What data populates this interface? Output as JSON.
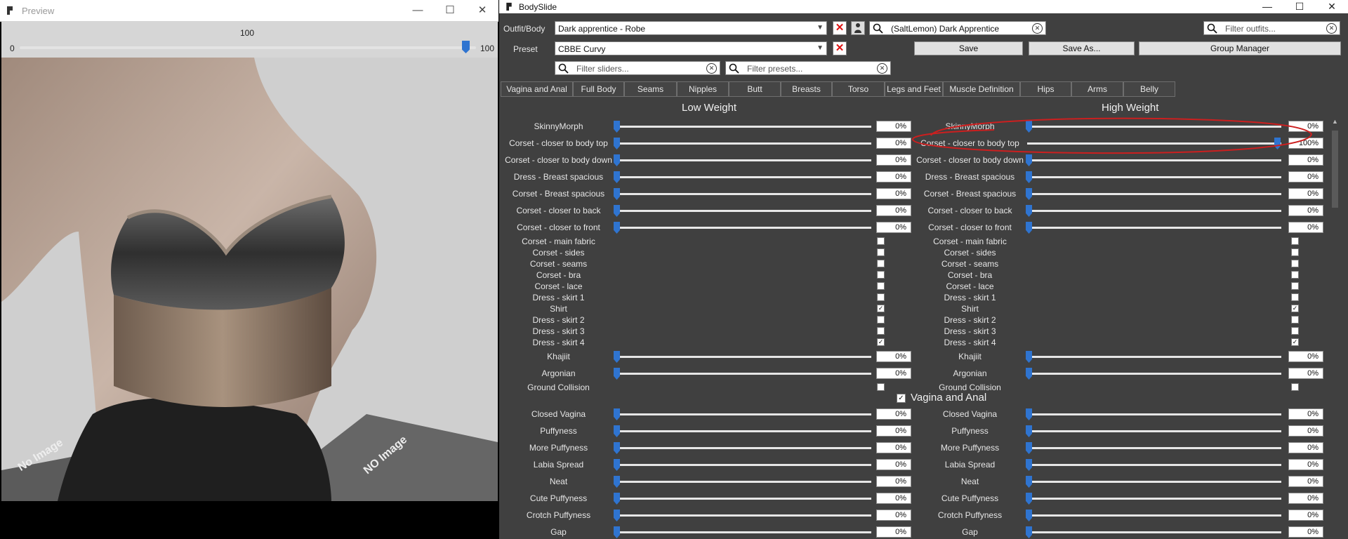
{
  "preview": {
    "title": "Preview",
    "slider_value": "100",
    "slider_min": "0",
    "slider_max": "100",
    "slider_level": 1.0,
    "floor_text": [
      "No Image",
      "NO",
      "Image",
      "NO",
      "Image",
      "NO",
      "Image",
      "NO",
      "Image"
    ]
  },
  "bodyslide": {
    "title": "BodySlide",
    "outfit_label": "Outfit/Body",
    "outfit_value": "Dark apprentice - Robe",
    "preset_label": "Preset",
    "preset_value": "CBBE Curvy",
    "outfit_search_value": "(SaltLemon) Dark Apprentice",
    "outfits_filter_placeholder": "Filter outfits...",
    "sliders_filter_placeholder": "Filter sliders...",
    "presets_filter_placeholder": "Filter presets...",
    "save_label": "Save",
    "save_as_label": "Save As...",
    "group_manager_label": "Group Manager",
    "tabs": [
      "Vagina and Anal",
      "Full Body",
      "Seams",
      "Nipples",
      "Butt",
      "Breasts",
      "Torso",
      "Legs and Feet",
      "Muscle Definition",
      "Hips",
      "Arms",
      "Belly"
    ],
    "low_weight_label": "Low Weight",
    "high_weight_label": "High Weight",
    "group_header": "Vagina and Anal",
    "group_checked": true
  },
  "sliders_top": [
    {
      "label": "SkinnyMorph",
      "type": "slider",
      "low": "0%",
      "high": "0%",
      "low_level": 0,
      "high_level": 0
    },
    {
      "label": "Corset - closer to body top",
      "type": "slider",
      "low": "0%",
      "high": "100%",
      "low_level": 0,
      "high_level": 1
    },
    {
      "label": "Corset - closer to body down",
      "type": "slider",
      "low": "0%",
      "high": "0%",
      "low_level": 0,
      "high_level": 0
    },
    {
      "label": "Dress - Breast spacious",
      "type": "slider",
      "low": "0%",
      "high": "0%",
      "low_level": 0,
      "high_level": 0
    },
    {
      "label": "Corset - Breast spacious",
      "type": "slider",
      "low": "0%",
      "high": "0%",
      "low_level": 0,
      "high_level": 0
    },
    {
      "label": "Corset - closer to back",
      "type": "slider",
      "low": "0%",
      "high": "0%",
      "low_level": 0,
      "high_level": 0
    },
    {
      "label": "Corset - closer to front",
      "type": "slider",
      "low": "0%",
      "high": "0%",
      "low_level": 0,
      "high_level": 0
    },
    {
      "label": "Corset - main fabric",
      "type": "check",
      "low_checked": false,
      "high_checked": false
    },
    {
      "label": "Corset - sides",
      "type": "check",
      "low_checked": false,
      "high_checked": false
    },
    {
      "label": "Corset - seams",
      "type": "check",
      "low_checked": false,
      "high_checked": false
    },
    {
      "label": "Corset - bra",
      "type": "check",
      "low_checked": false,
      "high_checked": false
    },
    {
      "label": "Corset - lace",
      "type": "check",
      "low_checked": false,
      "high_checked": false
    },
    {
      "label": "Dress - skirt 1",
      "type": "check",
      "low_checked": false,
      "high_checked": false
    },
    {
      "label": "Shirt",
      "type": "check",
      "low_checked": true,
      "high_checked": true
    },
    {
      "label": "Dress - skirt 2",
      "type": "check",
      "low_checked": false,
      "high_checked": false
    },
    {
      "label": "Dress - skirt 3",
      "type": "check",
      "low_checked": false,
      "high_checked": false
    },
    {
      "label": "Dress - skirt 4",
      "type": "check",
      "low_checked": true,
      "high_checked": true
    },
    {
      "label": "Khajiit",
      "type": "slider",
      "low": "0%",
      "high": "0%",
      "low_level": 0,
      "high_level": 0
    },
    {
      "label": "Argonian",
      "type": "slider",
      "low": "0%",
      "high": "0%",
      "low_level": 0,
      "high_level": 0
    },
    {
      "label": "Ground Collision",
      "type": "check",
      "low_checked": false,
      "high_checked": false
    }
  ],
  "sliders_group": [
    {
      "label": "Closed Vagina",
      "type": "slider",
      "low": "0%",
      "high": "0%",
      "low_level": 0,
      "high_level": 0
    },
    {
      "label": "Puffyness",
      "type": "slider",
      "low": "0%",
      "high": "0%",
      "low_level": 0,
      "high_level": 0
    },
    {
      "label": "More Puffyness",
      "type": "slider",
      "low": "0%",
      "high": "0%",
      "low_level": 0,
      "high_level": 0
    },
    {
      "label": "Labia Spread",
      "type": "slider",
      "low": "0%",
      "high": "0%",
      "low_level": 0,
      "high_level": 0
    },
    {
      "label": "Neat",
      "type": "slider",
      "low": "0%",
      "high": "0%",
      "low_level": 0,
      "high_level": 0
    },
    {
      "label": "Cute Puffyness",
      "type": "slider",
      "low": "0%",
      "high": "0%",
      "low_level": 0,
      "high_level": 0
    },
    {
      "label": "Crotch Puffyness",
      "type": "slider",
      "low": "0%",
      "high": "0%",
      "low_level": 0,
      "high_level": 0
    },
    {
      "label": "Gap",
      "type": "slider",
      "low": "0%",
      "high": "0%",
      "low_level": 0,
      "high_level": 0
    }
  ],
  "icons": [
    "window-icon",
    "minimize-icon",
    "maximize-icon",
    "close-icon",
    "delete-icon",
    "search-icon",
    "clear-search-icon",
    "dropdown-arrow-icon",
    "scroll-up-icon"
  ],
  "colors": {
    "accent": "#2f74d0",
    "panel": "#404040",
    "delete": "#d11111",
    "annotation": "#cc1f1f",
    "viewport": "#d6d6d6"
  }
}
